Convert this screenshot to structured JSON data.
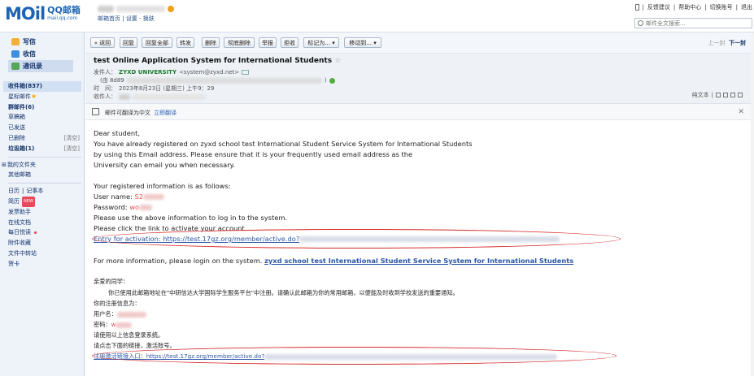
{
  "logo": {
    "mail": "MOil",
    "cn": "QQ邮箱",
    "url": "mail.qq.com"
  },
  "topnav": {
    "home": "邮箱首页",
    "settings": "设置",
    "switch": "换肤"
  },
  "toplinks": {
    "feedback": "反馈建议",
    "help": "帮助中心",
    "switch_account": "切换账号",
    "logout": "退出"
  },
  "search": {
    "placeholder": "邮件全文搜索..."
  },
  "sidebar": {
    "quick": [
      {
        "label": "写信",
        "icon": "pen-icon"
      },
      {
        "label": "收信",
        "icon": "inbox-icon"
      },
      {
        "label": "通讯录",
        "icon": "contacts-icon"
      }
    ],
    "folders": {
      "inbox": "收件箱(837)",
      "starred": "星标邮件",
      "group": "群邮件(6)",
      "drafts": "草稿箱",
      "sent": "已发送",
      "deleted": "已删除",
      "deleted_clear": "[清空]",
      "spam": "垃圾箱(1)",
      "spam_clear": "[清空]",
      "my_folders": "我的文件夹",
      "other": "其他邮箱",
      "calendar": "日历",
      "notes": "记事本",
      "resume": "简历",
      "new_badge": "NEW",
      "invoice": "发票助手",
      "docs": "在线文档",
      "daily": "每日悦读",
      "attach": "附件收藏",
      "transfer": "文件中转站",
      "cards": "贺卡"
    }
  },
  "toolbar": {
    "back": "« 返回",
    "reply": "回复",
    "reply_all": "回复全部",
    "forward": "转发",
    "delete": "删除",
    "delete_forever": "彻底删除",
    "report": "举报",
    "reject": "拒收",
    "mark_as": "标记为...",
    "move_to": "移动到...",
    "prev": "上一封",
    "next": "下一封"
  },
  "message": {
    "subject": "test Online Application System for International Students",
    "from_label": "发件人：",
    "from_name": "ZYXD UNIVERSITY",
    "from_email": "<system@zyxd.net>",
    "from_extra": "(由 8d89",
    "time_label": "时　间：",
    "time_value": "2023年8月23日 (星期三) 上午9：29",
    "to_label": "收件人：",
    "plain_text": "纯文本"
  },
  "translate": {
    "text": "邮件可翻译为中文",
    "link": "立即翻译"
  },
  "body": {
    "greeting": "Dear student,",
    "p1_l1": "You have already registered on zyxd school test International Student Service System for International Students",
    "p1_l2": "by using this Email address. Please ensure that it is your frequently used email address as the",
    "p1_l3": "University can email you when necessary.",
    "info_intro": "Your registered information is as follows:",
    "username_label": "User name: ",
    "username_value": "S2",
    "password_label": "Password: ",
    "password_value": "wo",
    "use_info": "Please use the above information to log in to the system.",
    "click_link": "Please click the link to activate your account.",
    "activation_link": "Entry for activation: https://test.17gz.org/member/active.do?",
    "more_info": "For more information, please login on the system. ",
    "system_link": "zyxd school test International Student Service System for International Students",
    "cn_greeting": "亲爱的同学：",
    "cn_p1": "你已使用此邮箱地址在\"中研信达大学国际学生服务平台\"中注册。请确认此邮箱为你的常用邮箱，以便能及时收到学校发送的重要通知。",
    "cn_info": "你的注册信息为：",
    "cn_username": "用户名：",
    "cn_password": "密码：",
    "cn_password_value": "w",
    "cn_use": "请使用以上信息登录系统。",
    "cn_click": "请点击下面的链接，激活账号。",
    "cn_link": "注册激活链接入口：https://test.17gz.org/member/active.do?"
  }
}
